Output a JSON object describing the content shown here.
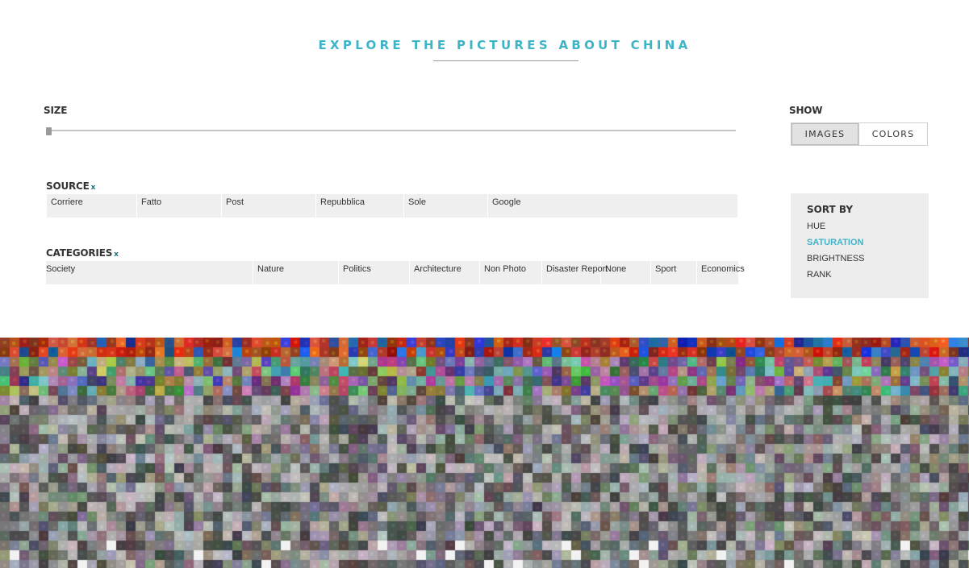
{
  "header": {
    "title": "EXPLORE THE PICTURES ABOUT CHINA"
  },
  "size": {
    "label": "SIZE"
  },
  "show": {
    "label": "SHOW",
    "options": [
      "IMAGES",
      "COLORS"
    ],
    "selected": "IMAGES"
  },
  "source": {
    "label": "SOURCE",
    "remove_mark": "x",
    "items": [
      "Corriere",
      "Fatto",
      "Post",
      "Repubblica",
      "Sole",
      "Google"
    ]
  },
  "categories": {
    "label": "CATEGORIES",
    "remove_mark": "x",
    "items": [
      "Society",
      "Nature",
      "Politics",
      "Architecture",
      "Non Photo",
      "Disaster Report",
      "None",
      "Sport",
      "Economics"
    ]
  },
  "sort": {
    "title": "SORT BY",
    "items": [
      "HUE",
      "SATURATION",
      "BRIGHTNESS",
      "RANK"
    ],
    "active": "SATURATION"
  },
  "colors": {
    "accent": "#3fb4c9",
    "panel": "#ededed"
  }
}
